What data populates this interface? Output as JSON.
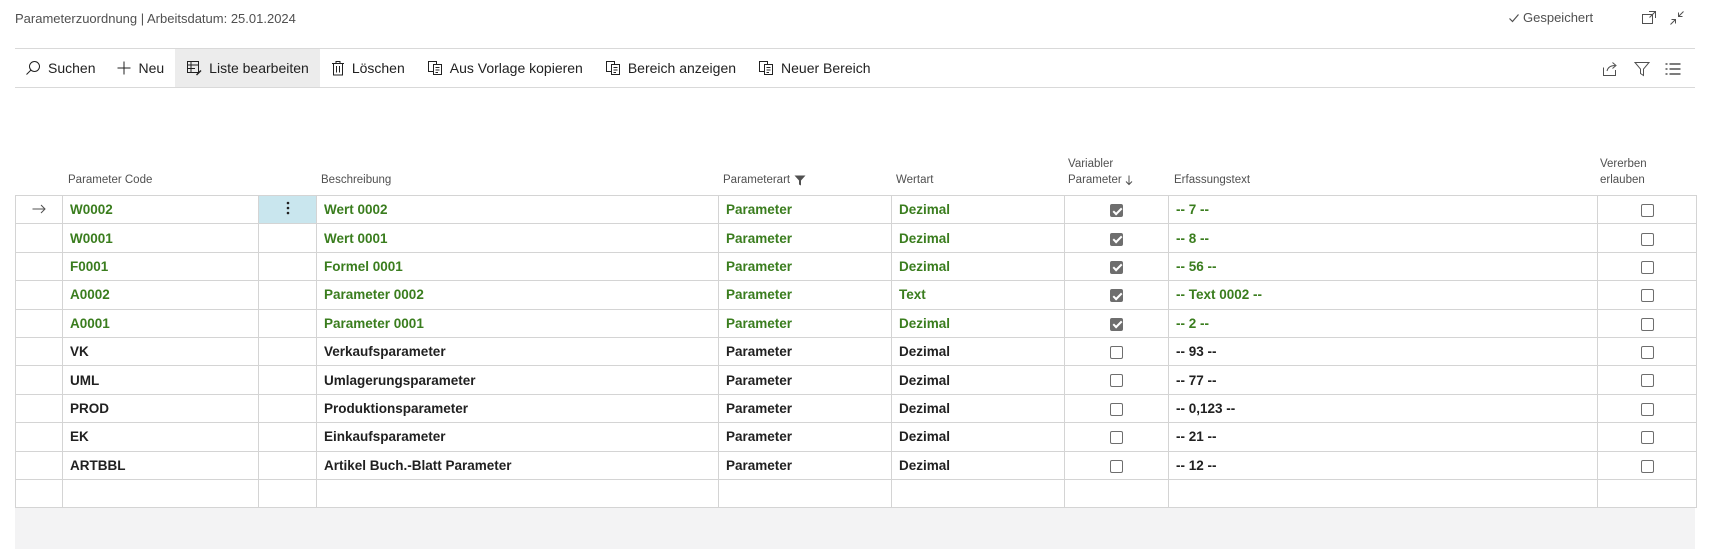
{
  "page": {
    "title": "Parameterzuordnung | Arbeitsdatum: 25.01.2024",
    "saved_status": "Gespeichert"
  },
  "actions": {
    "search": "Suchen",
    "new": "Neu",
    "edit_list": "Liste bearbeiten",
    "delete": "Löschen",
    "copy_template": "Aus Vorlage kopieren",
    "show_range": "Bereich anzeigen",
    "new_range": "Neuer Bereich"
  },
  "columns": {
    "code": "Parameter Code",
    "description": "Beschreibung",
    "param_type": "Parameterart",
    "value_type": "Wertart",
    "variable_line1": "Variabler",
    "variable_line2": "Parameter",
    "entry_text": "Erfassungstext",
    "inherit_line1": "Vererben",
    "inherit_line2": "erlauben"
  },
  "rows": [
    {
      "code": "W0002",
      "description": "Wert 0002",
      "param_type": "Parameter",
      "value_type": "Dezimal",
      "variable": true,
      "entry_text": "-- 7 --",
      "inherit": false,
      "highlight": true,
      "selected": true
    },
    {
      "code": "W0001",
      "description": "Wert 0001",
      "param_type": "Parameter",
      "value_type": "Dezimal",
      "variable": true,
      "entry_text": "-- 8 --",
      "inherit": false,
      "highlight": true
    },
    {
      "code": "F0001",
      "description": "Formel 0001",
      "param_type": "Parameter",
      "value_type": "Dezimal",
      "variable": true,
      "entry_text": "-- 56 --",
      "inherit": false,
      "highlight": true
    },
    {
      "code": "A0002",
      "description": "Parameter 0002",
      "param_type": "Parameter",
      "value_type": "Text",
      "variable": true,
      "entry_text": "-- Text 0002 --",
      "inherit": false,
      "highlight": true
    },
    {
      "code": "A0001",
      "description": "Parameter 0001",
      "param_type": "Parameter",
      "value_type": "Dezimal",
      "variable": true,
      "entry_text": "-- 2 --",
      "inherit": false,
      "highlight": true
    },
    {
      "code": "VK",
      "description": "Verkaufsparameter",
      "param_type": "Parameter",
      "value_type": "Dezimal",
      "variable": false,
      "entry_text": "-- 93 --",
      "inherit": false,
      "highlight": false
    },
    {
      "code": "UML",
      "description": "Umlagerungsparameter",
      "param_type": "Parameter",
      "value_type": "Dezimal",
      "variable": false,
      "entry_text": "-- 77 --",
      "inherit": false,
      "highlight": false
    },
    {
      "code": "PROD",
      "description": "Produktionsparameter",
      "param_type": "Parameter",
      "value_type": "Dezimal",
      "variable": false,
      "entry_text": "-- 0,123 --",
      "inherit": false,
      "highlight": false
    },
    {
      "code": "EK",
      "description": "Einkaufsparameter",
      "param_type": "Parameter",
      "value_type": "Dezimal",
      "variable": false,
      "entry_text": "-- 21 --",
      "inherit": false,
      "highlight": false
    },
    {
      "code": "ARTBBL",
      "description": "Artikel Buch.-Blatt Parameter",
      "param_type": "Parameter",
      "value_type": "Dezimal",
      "variable": false,
      "entry_text": "-- 12 --",
      "inherit": false,
      "highlight": false
    }
  ],
  "icons": {
    "selected_row": "arrow-right-icon",
    "row_menu": "vertical-dots-icon",
    "filter": "funnel-icon",
    "sort": "arrow-down-icon"
  },
  "colors": {
    "highlight_text": "#3a7d1e",
    "active_cell": "#c9e6ee"
  }
}
